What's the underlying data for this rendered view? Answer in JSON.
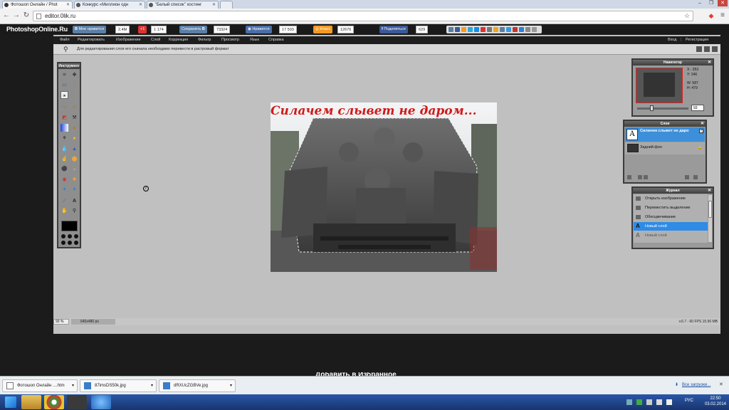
{
  "browser": {
    "tabs": [
      {
        "label": "Фотошоп Онлайн / Phot"
      },
      {
        "label": "Конкурс «Миллион одн"
      },
      {
        "label": "\"Белый список\" хостинг"
      }
    ],
    "url": "editor.0lik.ru"
  },
  "social": {
    "logo": "PhotoshopOnline.Ru",
    "vk_like_label": "Мне нравится",
    "vk_like_count": "2.4M",
    "gplus_label": "+1",
    "gplus_count": "1 174",
    "save_label": "Сохранить",
    "save_count": "73324",
    "like_label": "Нравится",
    "like_count": "17 503",
    "ok_label": "Класс",
    "ok_count": "12676",
    "share_label": "Поделиться",
    "share_count": "629"
  },
  "menu": {
    "items": [
      "Файл",
      "Редактировать",
      "Изображение",
      "Слой",
      "Коррекция",
      "Фильтр",
      "Просмотр",
      "Язык",
      "Справка"
    ],
    "login": "Вход",
    "register": "Регистрация"
  },
  "options_hint": "Для редактирования слоя его сначала необходимо перевести в растровый формат",
  "tools": {
    "title": "Инструмент"
  },
  "canvas": {
    "caption": "Силачем слывет не даром..."
  },
  "navigator": {
    "title": "Навигатор",
    "x_label": "X:",
    "x_value": "-353",
    "y_label": "Y:",
    "y_value": "246",
    "w_label": "W:",
    "w_value": "587",
    "h_label": "H:",
    "h_value": "479",
    "zoom": "93"
  },
  "layers": {
    "title": "Слои",
    "items": [
      {
        "name": "Силачем слывет не даро"
      },
      {
        "name": "Задний фон"
      }
    ]
  },
  "history": {
    "title": "Журнал",
    "items": [
      {
        "label": "Открыть изображение"
      },
      {
        "label": "Переместить выделение"
      },
      {
        "label": "Обесцвечивание"
      },
      {
        "label": "Новый слой"
      },
      {
        "label": "Новый слой"
      }
    ]
  },
  "status": {
    "zoom": "93",
    "zoom_unit": "%",
    "dimensions": "640x480 px",
    "fps": "v.6.7 - 60 FPS 15.96 MB"
  },
  "overlay_text": "Добавить в Избранное",
  "downloads": {
    "items": [
      {
        "name": "Фотошоп Онлайн ....htm"
      },
      {
        "name": "87imsDS50k.jpg"
      },
      {
        "name": "dRXUcZGBVe.jpg"
      }
    ],
    "all": "Все загрузки..."
  },
  "taskbar": {
    "lang": "РУС",
    "time": "22:50",
    "date": "03.02.2014"
  },
  "colors": {
    "accent_selected": "#3d8fd9",
    "history_selected": "#2f8be6",
    "caption_red": "#d11a1a"
  }
}
